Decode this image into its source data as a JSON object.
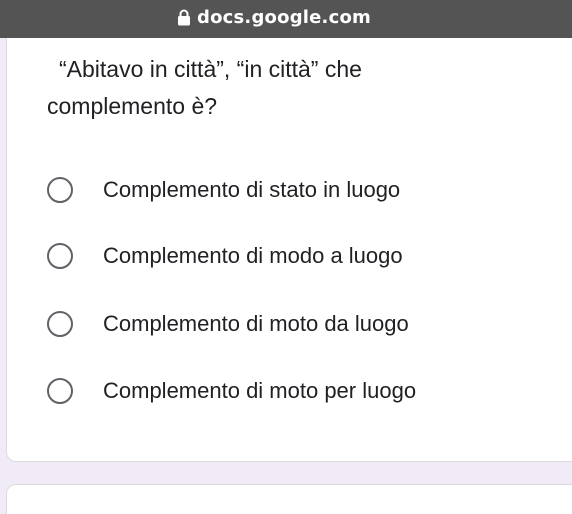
{
  "browser": {
    "url": "docs.google.com",
    "lock_icon": "lock-icon"
  },
  "question": {
    "title": "“Abitavo in città”, “in città” che complemento è?",
    "options": [
      {
        "label": "Complemento di stato in luogo",
        "selected": false
      },
      {
        "label": "Complemento di modo a luogo",
        "selected": false
      },
      {
        "label": "Complemento di moto da luogo",
        "selected": false
      },
      {
        "label": "Complemento di moto per luogo",
        "selected": false
      }
    ]
  },
  "colors": {
    "background": "#f0ebf7",
    "card": "#ffffff",
    "url_bar": "#545454",
    "radio_border": "#5f6368",
    "text": "#202124"
  }
}
